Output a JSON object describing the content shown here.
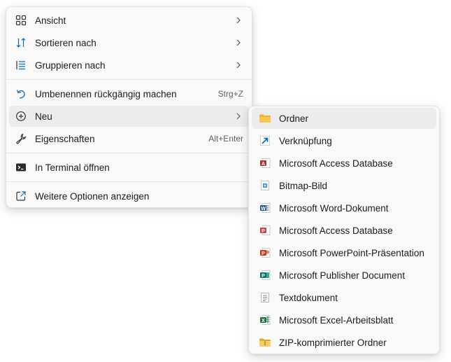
{
  "context_menu": {
    "items": [
      {
        "label": "Ansicht",
        "icon": "view-grid-icon"
      },
      {
        "label": "Sortieren nach",
        "icon": "sort-icon"
      },
      {
        "label": "Gruppieren nach",
        "icon": "group-list-icon"
      },
      {
        "label": "Umbenennen rückgängig machen",
        "shortcut": "Strg+Z",
        "icon": "undo-icon"
      },
      {
        "label": "Neu",
        "icon": "plus-circle-icon"
      },
      {
        "label": "Eigenschaften",
        "shortcut": "Alt+Enter",
        "icon": "wrench-icon"
      },
      {
        "label": "In Terminal öffnen",
        "icon": "terminal-icon"
      },
      {
        "label": "Weitere Optionen anzeigen",
        "icon": "open-external-icon"
      }
    ]
  },
  "new_submenu": {
    "items": [
      {
        "label": "Ordner",
        "icon": "folder-icon"
      },
      {
        "label": "Verknüpfung",
        "icon": "shortcut-arrow-icon"
      },
      {
        "label": "Microsoft Access Database",
        "icon": "access-icon"
      },
      {
        "label": "Bitmap-Bild",
        "icon": "bitmap-icon"
      },
      {
        "label": "Microsoft Word-Dokument",
        "icon": "word-icon"
      },
      {
        "label": "Microsoft Access Database",
        "icon": "access-icon"
      },
      {
        "label": "Microsoft PowerPoint-Präsentation",
        "icon": "powerpoint-icon"
      },
      {
        "label": "Microsoft Publisher Document",
        "icon": "publisher-icon"
      },
      {
        "label": "Textdokument",
        "icon": "text-document-icon"
      },
      {
        "label": "Microsoft Excel-Arbeitsblatt",
        "icon": "excel-icon"
      },
      {
        "label": "ZIP-komprimierter Ordner",
        "icon": "zip-folder-icon"
      }
    ]
  },
  "colors": {
    "menu_background": "#f9f9f9",
    "highlight": "#ececec",
    "access": "#a4373a",
    "word": "#2b579a",
    "powerpoint": "#c43e1c",
    "publisher": "#077568",
    "excel": "#217346",
    "folder": "#f8c54d",
    "shortcut_arrow": "#0a6cbd"
  }
}
